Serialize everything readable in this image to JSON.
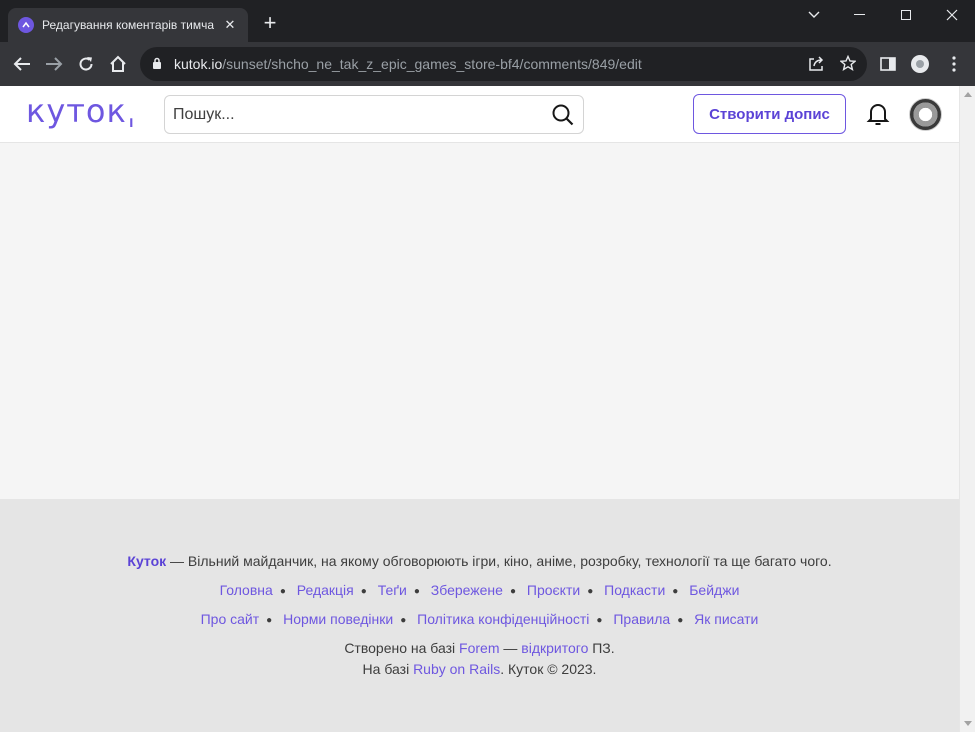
{
  "browser": {
    "tab_title": "Редагування коментарів тимчасово",
    "tab_close": "✕",
    "new_tab": "+",
    "url_host": "kutok.io",
    "url_path": "/sunset/shcho_ne_tak_z_epic_games_store-bf4/comments/849/edit"
  },
  "header": {
    "logo": "кутокˌ",
    "search_placeholder": "Пошук...",
    "create_button": "Створити допис"
  },
  "footer": {
    "brand": "Куток",
    "about_text": " — Вільний майданчик, на якому обговорюють ігри, кіно, аніме, розробку, технології та ще багато чого.",
    "nav1": [
      "Головна",
      "Редакція",
      "Теґи",
      "Збережене",
      "Проєкти",
      "Подкасти",
      "Бейджи"
    ],
    "nav2": [
      "Про сайт",
      "Норми поведінки",
      "Політика конфіденційності",
      "Правила",
      "Як писати"
    ],
    "built_prefix": "Створено на базі ",
    "built_forem": "Forem",
    "built_dash": " — ",
    "built_open": "відкритого",
    "built_suffix": " ПЗ.",
    "rails_prefix": "На базі ",
    "rails_link": "Ruby on Rails",
    "rails_suffix": ". Куток © 2023."
  },
  "colors": {
    "accent": "#6e57e0",
    "chrome_dark": "#202124",
    "chrome_tab": "#35363a",
    "page_bg": "#f5f5f5",
    "footer_bg": "#e5e5e5"
  }
}
